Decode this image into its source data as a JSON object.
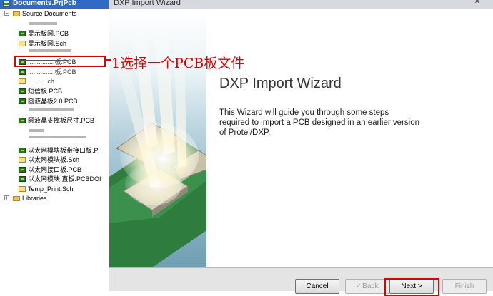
{
  "project_tree": {
    "root_label": "Documents.PrjPcb",
    "source_folder": "Source Documents",
    "items": [
      {
        "label": "显示板圆.PCB",
        "type": "pcb"
      },
      {
        "label": "显示板圆.Sch",
        "type": "sch"
      },
      {
        "label": "...............板.PCB",
        "type": "pcb"
      },
      {
        "label": "...............板.PCB",
        "type": "pcb"
      },
      {
        "label": "...........ch",
        "type": "sch"
      },
      {
        "label": "短信板.PCB",
        "type": "pcb"
      },
      {
        "label": "圆液晶板2.0.PCB",
        "type": "pcb"
      },
      {
        "label": "圆液晶支撑板尺寸.PCB",
        "type": "pcb"
      },
      {
        "label": "以太网模块板带接口板.P",
        "type": "pcb"
      },
      {
        "label": "以太网模块板.Sch",
        "type": "sch"
      },
      {
        "label": "以太网接口板.PCB",
        "type": "pcb"
      },
      {
        "label": "以太网模块 直板.PCBDOI",
        "type": "pcb"
      },
      {
        "label": "Temp_Print.Sch",
        "type": "sch"
      }
    ],
    "libraries_label": "Libraries"
  },
  "annotation": {
    "text": "1选择一个PCB板文件",
    "color": "#e00000"
  },
  "wizard": {
    "window_title": "DXP Import Wizard",
    "heading": "DXP Import Wizard",
    "description": "This Wizard will guide you through some steps required to import a PCB designed in an earlier version of Protel/DXP.",
    "buttons": {
      "cancel": "Cancel",
      "back": "< Back",
      "next": "Next >",
      "finish": "Finish"
    }
  },
  "colors": {
    "selection_highlight": "#e00000",
    "title_bar_active": "#316ac5",
    "pcb_green": "#1f7a1f"
  }
}
